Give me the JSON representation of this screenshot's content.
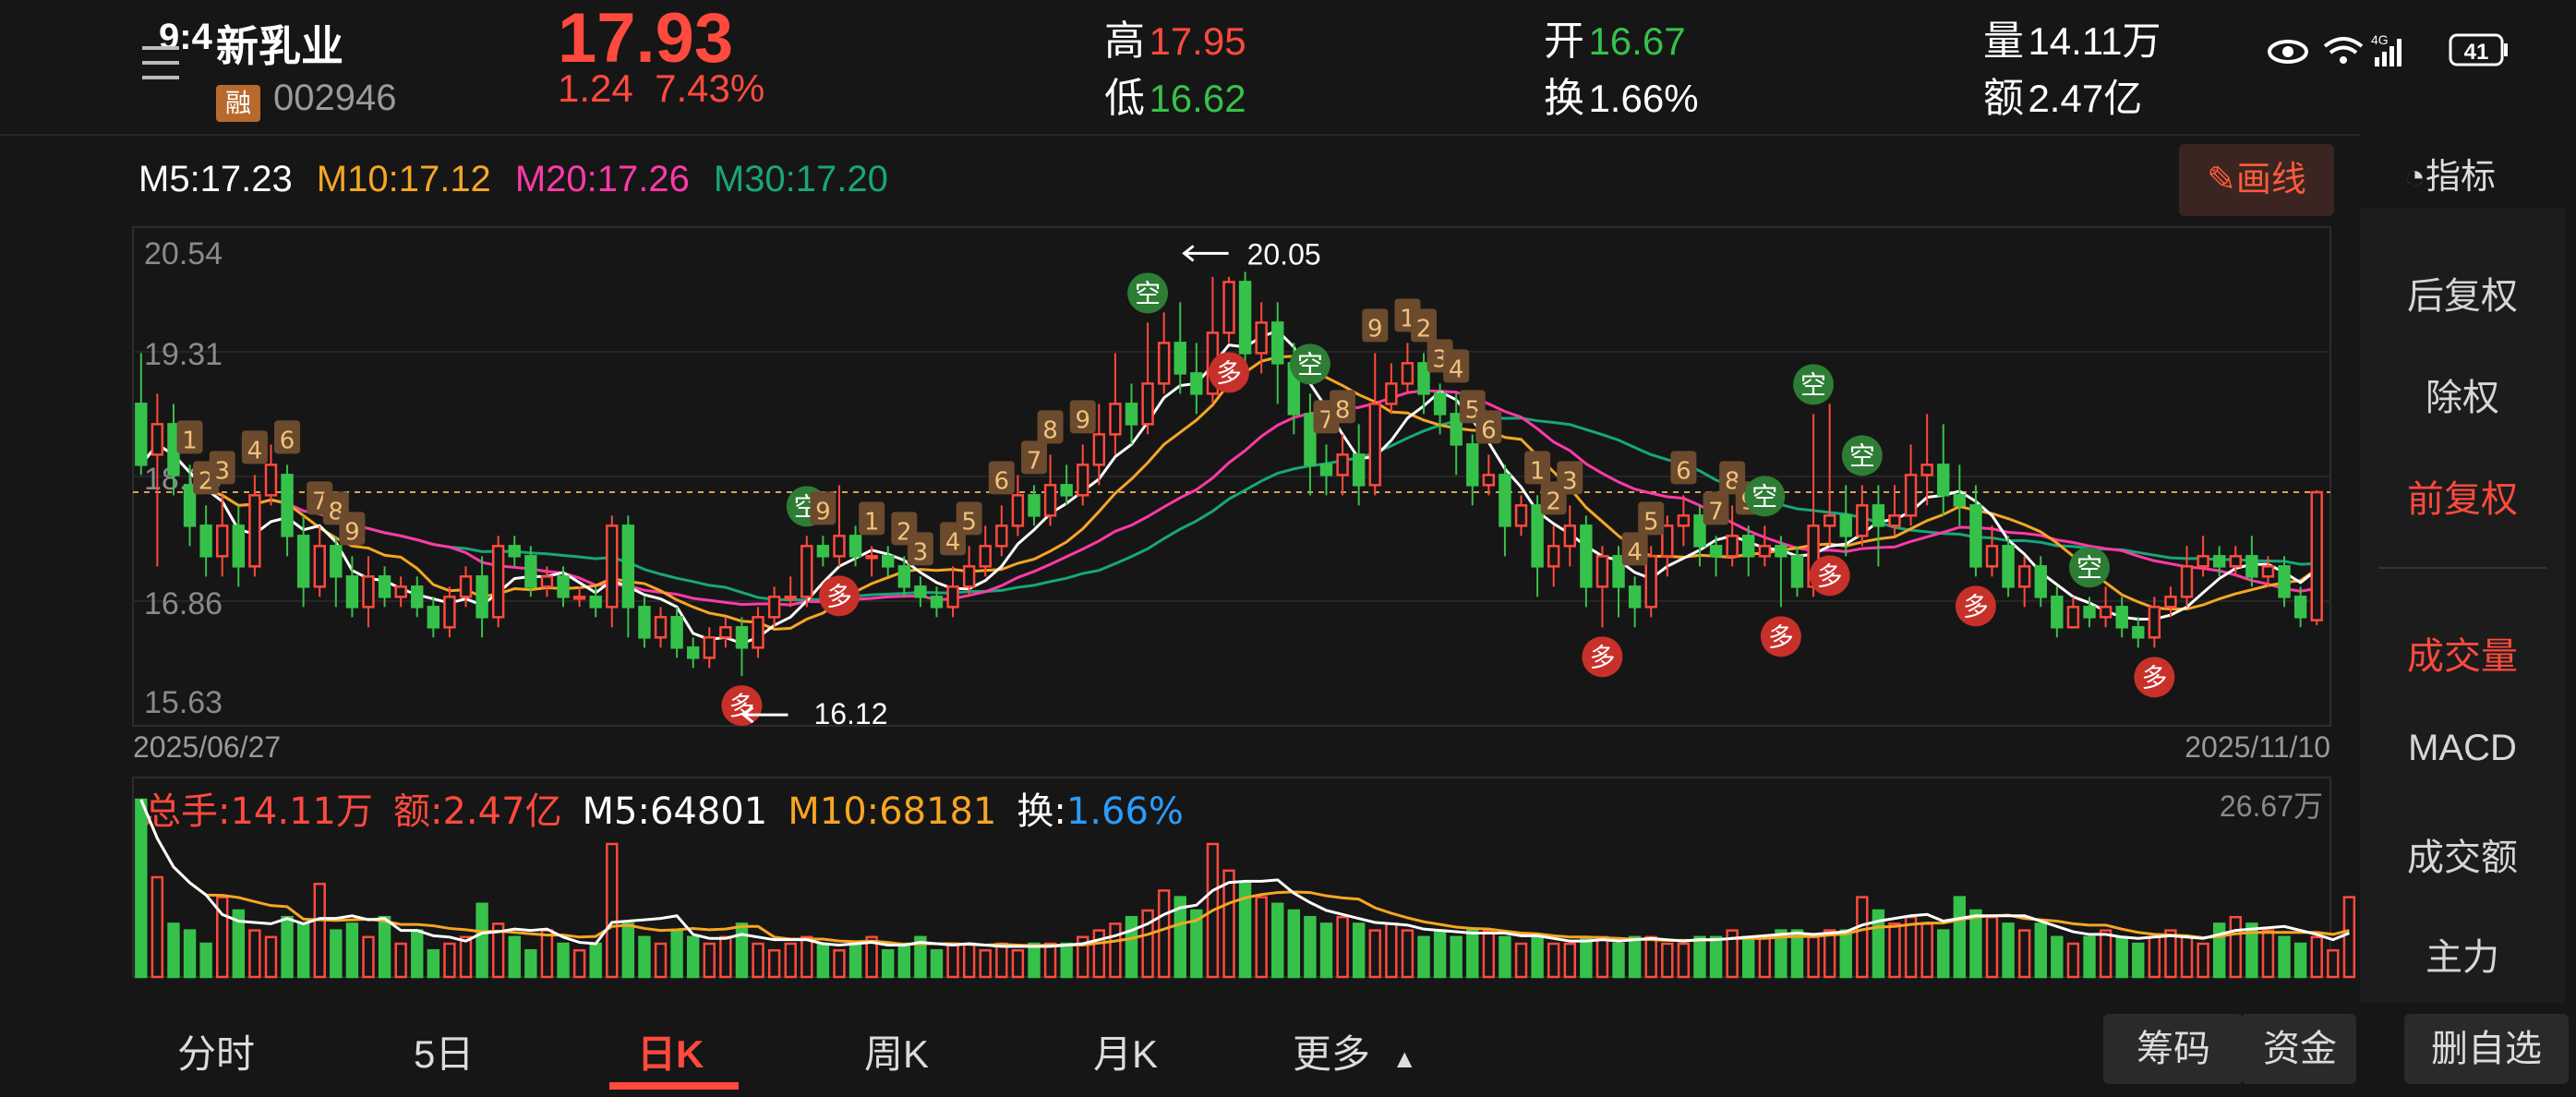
{
  "status_bar": {
    "time": "9:4",
    "battery": "41"
  },
  "stock": {
    "name": "新乳业",
    "badge": "融",
    "code": "002946",
    "price": "17.93",
    "change": "1.24",
    "change_pct": "7.43%"
  },
  "quote": {
    "high_label": "高",
    "high": "17.95",
    "low_label": "低",
    "low": "16.62",
    "open_label": "开",
    "open": "16.67",
    "turnover_label": "换",
    "turnover": "1.66%",
    "volume_label": "量",
    "volume": "14.11万",
    "amount_label": "额",
    "amount": "2.47亿"
  },
  "ma": {
    "m5": "M5:17.23",
    "m10": "M10:17.12",
    "m20": "M20:17.26",
    "m30": "M30:17.20"
  },
  "buttons": {
    "draw": "画线",
    "indicator": "指标"
  },
  "right_panel": [
    "后复权",
    "除权",
    "前复权",
    "成交量",
    "MACD",
    "成交额",
    "主力"
  ],
  "right_panel_active": [
    "前复权",
    "成交量"
  ],
  "price_axis": {
    "labels": [
      "20.54",
      "19.31",
      "18.09",
      "16.86",
      "15.63"
    ]
  },
  "date_range": {
    "start": "2025/06/27",
    "end": "2025/11/10"
  },
  "annotations": {
    "high": "20.05",
    "low": "16.12"
  },
  "signal_labels": {
    "buy": "多",
    "sell": "空"
  },
  "volume_legend": {
    "total": "总手:14.11万",
    "amount": "额:2.47亿",
    "m5": "M5:64801",
    "m10": "M10:68181",
    "turnover_label": "换:",
    "turnover_value": "1.66%",
    "max": "26.67万"
  },
  "tabs": [
    "分时",
    "5日",
    "日K",
    "周K",
    "月K",
    "更多"
  ],
  "active_tab": "日K",
  "actions": {
    "chips": "筹码",
    "funds": "资金",
    "remove": "删自选"
  },
  "colors": {
    "up": "#ff4a3d",
    "down": "#36c24a",
    "ma5": "#ffffff",
    "ma10": "#f6a623",
    "ma20": "#ff3aa8",
    "ma30": "#17a67a",
    "accent": "#ff4a3d"
  },
  "chart_data": {
    "type": "candlestick",
    "y_range": [
      15.63,
      20.54
    ],
    "reference_price": 17.93,
    "candles": [
      [
        18.8,
        18.2,
        19.3,
        18.1
      ],
      [
        18.3,
        18.6,
        18.9,
        17.2
      ],
      [
        18.6,
        18.1,
        18.8,
        17.9
      ],
      [
        18.0,
        17.6,
        18.2,
        17.4
      ],
      [
        17.6,
        17.3,
        17.8,
        17.1
      ],
      [
        17.3,
        17.6,
        17.9,
        17.1
      ],
      [
        17.6,
        17.2,
        17.8,
        17.0
      ],
      [
        17.2,
        17.9,
        18.1,
        17.1
      ],
      [
        17.9,
        18.2,
        18.4,
        17.8
      ],
      [
        18.1,
        17.5,
        18.2,
        17.3
      ],
      [
        17.5,
        17.0,
        17.7,
        16.8
      ],
      [
        17.0,
        17.4,
        17.6,
        16.9
      ],
      [
        17.4,
        17.1,
        17.5,
        16.8
      ],
      [
        17.1,
        16.8,
        17.3,
        16.7
      ],
      [
        16.8,
        17.1,
        17.3,
        16.6
      ],
      [
        17.1,
        16.9,
        17.2,
        16.8
      ],
      [
        16.9,
        17.0,
        17.1,
        16.8
      ],
      [
        17.0,
        16.8,
        17.1,
        16.7
      ],
      [
        16.8,
        16.6,
        16.9,
        16.5
      ],
      [
        16.6,
        16.9,
        17.0,
        16.5
      ],
      [
        16.9,
        17.1,
        17.2,
        16.8
      ],
      [
        17.1,
        16.7,
        17.3,
        16.5
      ],
      [
        16.7,
        17.4,
        17.5,
        16.6
      ],
      [
        17.4,
        17.3,
        17.5,
        17.2
      ],
      [
        17.3,
        17.0,
        17.4,
        16.9
      ],
      [
        17.0,
        17.1,
        17.2,
        16.9
      ],
      [
        17.1,
        16.9,
        17.2,
        16.8
      ],
      [
        16.9,
        16.9,
        17.0,
        16.8
      ],
      [
        16.9,
        16.8,
        17.0,
        16.7
      ],
      [
        16.8,
        17.6,
        17.7,
        16.6
      ],
      [
        17.6,
        16.8,
        17.7,
        16.5
      ],
      [
        16.8,
        16.5,
        16.9,
        16.4
      ],
      [
        16.5,
        16.7,
        16.8,
        16.4
      ],
      [
        16.7,
        16.4,
        16.8,
        16.3
      ],
      [
        16.4,
        16.3,
        16.5,
        16.2
      ],
      [
        16.3,
        16.5,
        16.6,
        16.2
      ],
      [
        16.5,
        16.6,
        16.7,
        16.4
      ],
      [
        16.6,
        16.4,
        16.7,
        16.12
      ],
      [
        16.4,
        16.7,
        16.8,
        16.3
      ],
      [
        16.7,
        16.9,
        17.0,
        16.6
      ],
      [
        16.9,
        16.9,
        17.1,
        16.8
      ],
      [
        16.9,
        17.4,
        17.5,
        16.8
      ],
      [
        17.4,
        17.3,
        17.5,
        17.2
      ],
      [
        17.3,
        17.5,
        18.0,
        17.2
      ],
      [
        17.5,
        17.3,
        17.6,
        17.2
      ],
      [
        17.3,
        17.3,
        17.4,
        17.1
      ],
      [
        17.3,
        17.2,
        17.4,
        17.1
      ],
      [
        17.2,
        17.0,
        17.3,
        16.9
      ],
      [
        17.0,
        16.9,
        17.1,
        16.8
      ],
      [
        16.9,
        16.8,
        17.0,
        16.7
      ],
      [
        16.8,
        17.0,
        17.2,
        16.7
      ],
      [
        17.0,
        17.2,
        17.4,
        16.9
      ],
      [
        17.2,
        17.4,
        17.6,
        17.1
      ],
      [
        17.4,
        17.6,
        17.8,
        17.3
      ],
      [
        17.6,
        17.9,
        18.1,
        17.5
      ],
      [
        17.9,
        17.7,
        18.0,
        17.6
      ],
      [
        17.7,
        18.0,
        18.3,
        17.6
      ],
      [
        18.0,
        17.9,
        18.2,
        17.8
      ],
      [
        17.9,
        18.2,
        18.4,
        17.8
      ],
      [
        18.2,
        18.5,
        18.8,
        18.0
      ],
      [
        18.5,
        18.8,
        19.3,
        18.3
      ],
      [
        18.8,
        18.6,
        19.0,
        18.4
      ],
      [
        18.6,
        19.0,
        19.6,
        18.5
      ],
      [
        19.0,
        19.4,
        19.7,
        18.9
      ],
      [
        19.4,
        19.1,
        19.8,
        18.9
      ],
      [
        19.1,
        18.9,
        19.4,
        18.7
      ],
      [
        18.9,
        19.5,
        20.05,
        18.8
      ],
      [
        19.5,
        20.0,
        20.05,
        19.4
      ],
      [
        20.0,
        19.3,
        20.1,
        19.0
      ],
      [
        19.3,
        19.6,
        19.8,
        19.1
      ],
      [
        19.6,
        19.2,
        19.8,
        18.8
      ],
      [
        19.2,
        18.7,
        19.4,
        18.5
      ],
      [
        18.7,
        18.2,
        18.9,
        17.9
      ],
      [
        18.2,
        18.1,
        18.4,
        17.9
      ],
      [
        18.1,
        18.3,
        18.5,
        17.9
      ],
      [
        18.3,
        18.0,
        18.6,
        17.8
      ],
      [
        18.0,
        18.8,
        19.3,
        17.9
      ],
      [
        18.8,
        19.0,
        19.2,
        18.7
      ],
      [
        19.0,
        19.2,
        19.4,
        18.9
      ],
      [
        19.2,
        18.9,
        19.3,
        18.7
      ],
      [
        18.9,
        18.7,
        19.0,
        18.5
      ],
      [
        18.7,
        18.4,
        18.9,
        18.1
      ],
      [
        18.4,
        18.0,
        18.5,
        17.8
      ],
      [
        18.0,
        18.1,
        18.3,
        17.9
      ],
      [
        18.1,
        17.6,
        18.2,
        17.3
      ],
      [
        17.6,
        17.8,
        17.9,
        17.5
      ],
      [
        17.8,
        17.2,
        17.9,
        16.9
      ],
      [
        17.2,
        17.4,
        17.6,
        17.0
      ],
      [
        17.4,
        17.6,
        17.8,
        17.2
      ],
      [
        17.6,
        17.0,
        17.7,
        16.8
      ],
      [
        17.0,
        17.3,
        17.4,
        16.6
      ],
      [
        17.3,
        17.0,
        17.4,
        16.7
      ],
      [
        17.0,
        16.8,
        17.1,
        16.6
      ],
      [
        16.8,
        17.3,
        17.4,
        16.7
      ],
      [
        17.3,
        17.6,
        17.7,
        17.1
      ],
      [
        17.6,
        17.7,
        17.9,
        17.4
      ],
      [
        17.7,
        17.4,
        17.8,
        17.2
      ],
      [
        17.4,
        17.3,
        17.5,
        17.1
      ],
      [
        17.3,
        17.5,
        17.8,
        17.2
      ],
      [
        17.5,
        17.3,
        17.6,
        17.1
      ],
      [
        17.3,
        17.4,
        17.6,
        17.2
      ],
      [
        17.4,
        17.3,
        17.5,
        16.8
      ],
      [
        17.3,
        17.0,
        17.4,
        16.9
      ],
      [
        17.0,
        17.6,
        18.7,
        16.9
      ],
      [
        17.6,
        17.7,
        18.8,
        17.4
      ],
      [
        17.7,
        17.5,
        18.0,
        17.3
      ],
      [
        17.5,
        17.8,
        18.0,
        17.4
      ],
      [
        17.8,
        17.6,
        18.0,
        17.2
      ],
      [
        17.6,
        17.7,
        18.0,
        17.5
      ],
      [
        17.7,
        18.1,
        18.4,
        17.6
      ],
      [
        18.1,
        18.2,
        18.7,
        17.8
      ],
      [
        18.2,
        17.9,
        18.6,
        17.7
      ],
      [
        17.9,
        17.8,
        18.2,
        17.6
      ],
      [
        17.8,
        17.2,
        18.0,
        17.1
      ],
      [
        17.2,
        17.4,
        17.6,
        17.1
      ],
      [
        17.4,
        17.0,
        17.5,
        16.9
      ],
      [
        17.0,
        17.2,
        17.3,
        16.8
      ],
      [
        17.2,
        16.9,
        17.3,
        16.8
      ],
      [
        16.9,
        16.6,
        17.0,
        16.5
      ],
      [
        16.6,
        16.8,
        16.9,
        16.6
      ],
      [
        16.8,
        16.7,
        16.9,
        16.6
      ],
      [
        16.7,
        16.8,
        17.0,
        16.6
      ],
      [
        16.8,
        16.6,
        16.9,
        16.5
      ],
      [
        16.6,
        16.5,
        16.7,
        16.4
      ],
      [
        16.5,
        16.8,
        16.9,
        16.4
      ],
      [
        16.8,
        16.9,
        17.0,
        16.7
      ],
      [
        16.9,
        17.2,
        17.4,
        16.8
      ],
      [
        17.2,
        17.3,
        17.5,
        17.1
      ],
      [
        17.3,
        17.2,
        17.4,
        17.1
      ],
      [
        17.2,
        17.3,
        17.4,
        17.1
      ],
      [
        17.3,
        17.1,
        17.5,
        17.0
      ],
      [
        17.1,
        17.2,
        17.3,
        17.0
      ],
      [
        17.2,
        16.9,
        17.3,
        16.8
      ],
      [
        16.9,
        16.7,
        17.0,
        16.6
      ],
      [
        16.67,
        17.93,
        17.95,
        16.62
      ]
    ],
    "volumes": [
      26.67,
      15,
      8,
      7,
      5,
      12,
      10,
      7,
      6,
      9,
      8,
      14,
      7,
      8,
      6,
      9,
      5,
      7,
      4,
      5,
      6,
      11,
      8,
      6,
      4,
      7,
      5,
      4,
      5,
      20,
      8,
      6,
      5,
      7,
      6,
      5,
      6,
      8,
      5,
      4,
      5,
      6,
      5,
      4,
      5,
      6,
      4,
      5,
      6,
      4,
      5,
      5,
      4,
      5,
      4,
      5,
      5,
      5,
      6,
      7,
      8,
      9,
      10,
      13,
      12,
      10,
      20,
      16,
      14,
      12,
      11,
      10,
      9,
      8,
      9,
      8,
      7,
      8,
      7,
      6,
      7,
      6,
      7,
      7,
      6,
      5,
      6,
      5,
      5,
      6,
      6,
      5,
      6,
      6,
      5,
      5,
      6,
      6,
      7,
      6,
      6,
      7,
      7,
      6,
      7,
      7,
      12,
      10,
      8,
      9,
      8,
      7,
      12,
      10,
      9,
      8,
      7,
      8,
      6,
      5,
      6,
      7,
      6,
      5,
      6,
      7,
      6,
      5,
      8,
      9,
      8,
      7,
      6,
      5,
      6,
      4,
      12
    ],
    "signals": [
      {
        "i": 9,
        "t": "5"
      },
      {
        "i": 11,
        "t": "7"
      },
      {
        "i": 12,
        "t": "8"
      },
      {
        "i": 13,
        "t": "9"
      },
      {
        "i": 3,
        "t": "1"
      },
      {
        "i": 4,
        "t": "2"
      },
      {
        "i": 5,
        "t": "3"
      },
      {
        "i": 7,
        "t": "4"
      },
      {
        "i": 9,
        "t": "6"
      },
      {
        "i": 37,
        "t": "多",
        "kind": "buy"
      },
      {
        "i": 41,
        "t": "空",
        "kind": "sell"
      },
      {
        "i": 42,
        "t": "9"
      },
      {
        "i": 43,
        "t": "多",
        "kind": "buy"
      },
      {
        "i": 45,
        "t": "1"
      },
      {
        "i": 47,
        "t": "2"
      },
      {
        "i": 48,
        "t": "3"
      },
      {
        "i": 50,
        "t": "4"
      },
      {
        "i": 51,
        "t": "5"
      },
      {
        "i": 53,
        "t": "6"
      },
      {
        "i": 55,
        "t": "7"
      },
      {
        "i": 56,
        "t": "8"
      },
      {
        "i": 58,
        "t": "9"
      },
      {
        "i": 62,
        "t": "空",
        "kind": "sell"
      },
      {
        "i": 67,
        "t": "多",
        "kind": "buy"
      },
      {
        "i": 72,
        "t": "空",
        "kind": "sell"
      },
      {
        "i": 73,
        "t": "7"
      },
      {
        "i": 74,
        "t": "8"
      },
      {
        "i": 76,
        "t": "9"
      },
      {
        "i": 78,
        "t": "1"
      },
      {
        "i": 79,
        "t": "2"
      },
      {
        "i": 80,
        "t": "3"
      },
      {
        "i": 81,
        "t": "4"
      },
      {
        "i": 82,
        "t": "5"
      },
      {
        "i": 83,
        "t": "6"
      },
      {
        "i": 86,
        "t": "1"
      },
      {
        "i": 87,
        "t": "2"
      },
      {
        "i": 88,
        "t": "3"
      },
      {
        "i": 90,
        "t": "多",
        "kind": "buy"
      },
      {
        "i": 92,
        "t": "4"
      },
      {
        "i": 93,
        "t": "5"
      },
      {
        "i": 95,
        "t": "6"
      },
      {
        "i": 97,
        "t": "7"
      },
      {
        "i": 98,
        "t": "8"
      },
      {
        "i": 99,
        "t": "9"
      },
      {
        "i": 100,
        "t": "空",
        "kind": "sell"
      },
      {
        "i": 101,
        "t": "多",
        "kind": "buy"
      },
      {
        "i": 103,
        "t": "空",
        "kind": "sell"
      },
      {
        "i": 104,
        "t": "多",
        "kind": "buy"
      },
      {
        "i": 106,
        "t": "空",
        "kind": "sell"
      },
      {
        "i": 113,
        "t": "多",
        "kind": "buy"
      },
      {
        "i": 120,
        "t": "空",
        "kind": "sell"
      },
      {
        "i": 124,
        "t": "多",
        "kind": "buy"
      }
    ]
  }
}
